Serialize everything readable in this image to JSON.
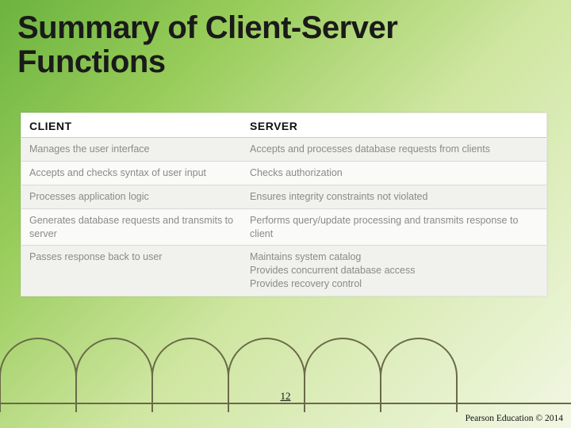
{
  "title_line1": "Summary of Client-Server",
  "title_line2": "Functions",
  "table": {
    "headers": {
      "client": "CLIENT",
      "server": "SERVER"
    },
    "rows": [
      {
        "client": "Manages the user interface",
        "server": "Accepts and processes database requests from clients"
      },
      {
        "client": "Accepts and checks syntax of user input",
        "server": "Checks authorization"
      },
      {
        "client": "Processes application logic",
        "server": "Ensures integrity constraints not violated"
      },
      {
        "client": "Generates database requests and transmits to server",
        "server": "Performs query/update processing and transmits response to client"
      },
      {
        "client": "Passes response back to user",
        "server": "Maintains system catalog\nProvides concurrent database access\nProvides recovery control"
      }
    ]
  },
  "page_number": "12",
  "copyright": "Pearson Education © 2014"
}
